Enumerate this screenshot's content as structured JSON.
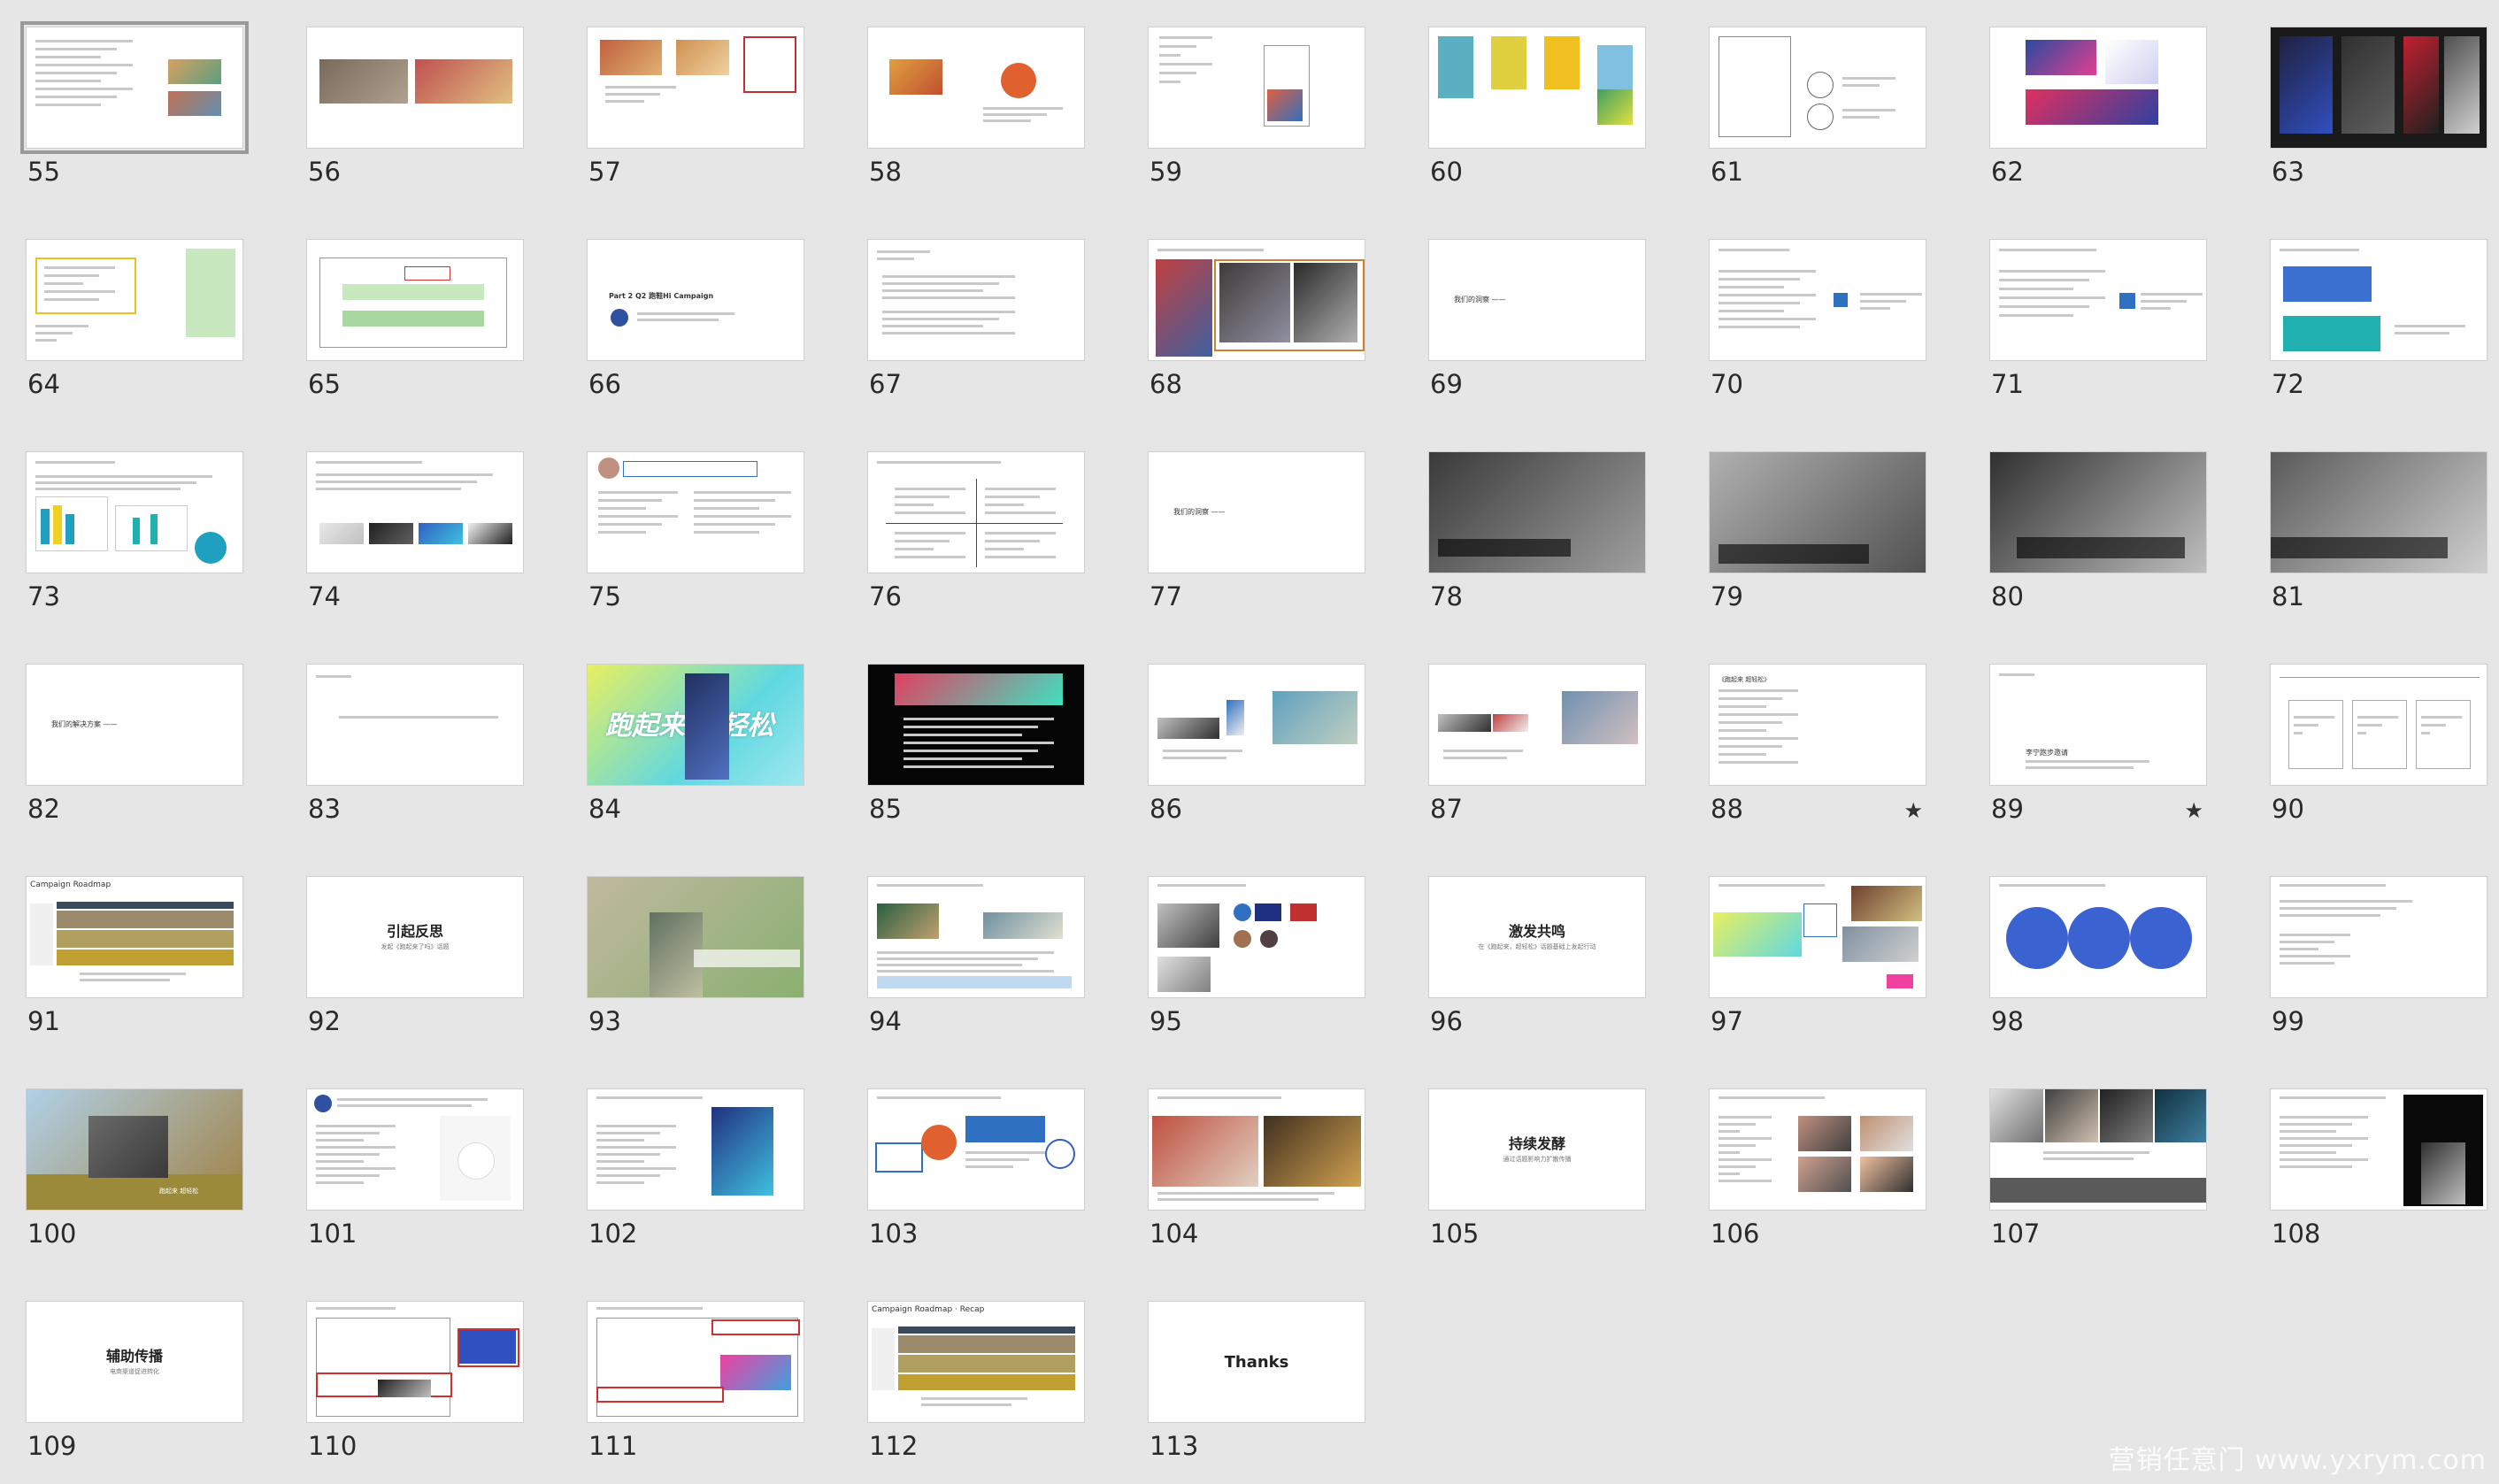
{
  "slides": [
    {
      "n": "55"
    },
    {
      "n": "56"
    },
    {
      "n": "57"
    },
    {
      "n": "58"
    },
    {
      "n": "59"
    },
    {
      "n": "60"
    },
    {
      "n": "61"
    },
    {
      "n": "62"
    },
    {
      "n": "63"
    },
    {
      "n": "64"
    },
    {
      "n": "65"
    },
    {
      "n": "66",
      "title": "Part 2  Q2 跑鞋Hi Campaign"
    },
    {
      "n": "67"
    },
    {
      "n": "68"
    },
    {
      "n": "69",
      "title": "我们的洞察 ——"
    },
    {
      "n": "70"
    },
    {
      "n": "71"
    },
    {
      "n": "72"
    },
    {
      "n": "73"
    },
    {
      "n": "74"
    },
    {
      "n": "75"
    },
    {
      "n": "76"
    },
    {
      "n": "77",
      "title": "我们的洞察 ——"
    },
    {
      "n": "78"
    },
    {
      "n": "79"
    },
    {
      "n": "80"
    },
    {
      "n": "81"
    },
    {
      "n": "82",
      "title": "我们的解决方案 ——"
    },
    {
      "n": "83"
    },
    {
      "n": "84",
      "title": "跑起来 超轻松"
    },
    {
      "n": "85"
    },
    {
      "n": "86"
    },
    {
      "n": "87"
    },
    {
      "n": "88",
      "title": "《跑起来 超轻松》",
      "star": "★"
    },
    {
      "n": "89",
      "title": "李宁跑步邀请",
      "star": "★"
    },
    {
      "n": "90"
    },
    {
      "n": "91",
      "title": "Campaign Roadmap"
    },
    {
      "n": "92",
      "title": "引起反思",
      "subtitle": "发起《跑起来了吗》话题"
    },
    {
      "n": "93"
    },
    {
      "n": "94"
    },
    {
      "n": "95"
    },
    {
      "n": "96",
      "title": "激发共鸣",
      "subtitle": "在《跑起来，超轻松》话题基础上发起行动"
    },
    {
      "n": "97"
    },
    {
      "n": "98"
    },
    {
      "n": "99"
    },
    {
      "n": "100",
      "title": "跑起来 超轻松"
    },
    {
      "n": "101"
    },
    {
      "n": "102"
    },
    {
      "n": "103"
    },
    {
      "n": "104"
    },
    {
      "n": "105",
      "title": "持续发酵",
      "subtitle": "通过话题影响力扩散传播"
    },
    {
      "n": "106"
    },
    {
      "n": "107"
    },
    {
      "n": "108"
    },
    {
      "n": "109",
      "title": "辅助传播",
      "subtitle": "电商渠道促进转化"
    },
    {
      "n": "110"
    },
    {
      "n": "111"
    },
    {
      "n": "112",
      "title": "Campaign Roadmap · Recap"
    },
    {
      "n": "113",
      "title": "Thanks"
    }
  ],
  "selected": "55",
  "watermark": "营销任意门 www.yxrym.com"
}
